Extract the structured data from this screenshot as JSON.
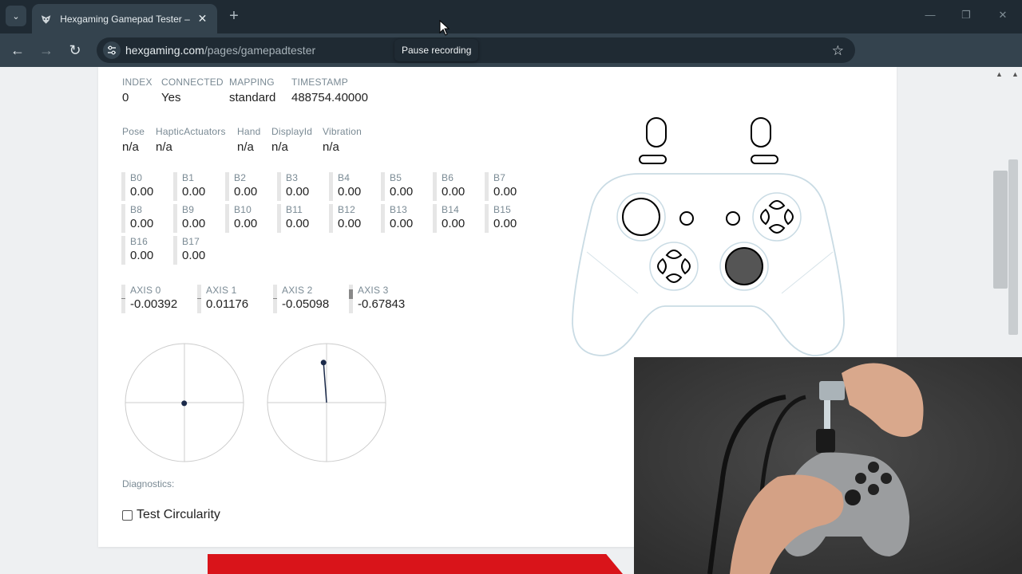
{
  "browser": {
    "tab_title": "Hexgaming Gamepad Tester – H",
    "url_domain": "hexgaming.com",
    "url_path": "/pages/gamepadtester",
    "tooltip": "Pause recording",
    "tab_menu_icon": "chevron-down-icon",
    "new_tab_symbol": "+",
    "close_symbol": "✕"
  },
  "gamepad": {
    "info": [
      {
        "label": "INDEX",
        "value": "0"
      },
      {
        "label": "CONNECTED",
        "value": "Yes"
      },
      {
        "label": "MAPPING",
        "value": "standard"
      },
      {
        "label": "TIMESTAMP",
        "value": "488754.40000"
      }
    ],
    "props": [
      {
        "label": "Pose",
        "value": "n/a"
      },
      {
        "label": "HapticActuators",
        "value": "n/a"
      },
      {
        "label": "Hand",
        "value": "n/a"
      },
      {
        "label": "DisplayId",
        "value": "n/a"
      },
      {
        "label": "Vibration",
        "value": "n/a"
      }
    ],
    "buttons": [
      {
        "label": "B0",
        "value": "0.00"
      },
      {
        "label": "B1",
        "value": "0.00"
      },
      {
        "label": "B2",
        "value": "0.00"
      },
      {
        "label": "B3",
        "value": "0.00"
      },
      {
        "label": "B4",
        "value": "0.00"
      },
      {
        "label": "B5",
        "value": "0.00"
      },
      {
        "label": "B6",
        "value": "0.00"
      },
      {
        "label": "B7",
        "value": "0.00"
      },
      {
        "label": "B8",
        "value": "0.00"
      },
      {
        "label": "B9",
        "value": "0.00"
      },
      {
        "label": "B10",
        "value": "0.00"
      },
      {
        "label": "B11",
        "value": "0.00"
      },
      {
        "label": "B12",
        "value": "0.00"
      },
      {
        "label": "B13",
        "value": "0.00"
      },
      {
        "label": "B14",
        "value": "0.00"
      },
      {
        "label": "B15",
        "value": "0.00"
      },
      {
        "label": "B16",
        "value": "0.00"
      },
      {
        "label": "B17",
        "value": "0.00"
      }
    ],
    "axes": [
      {
        "label": "AXIS 0",
        "value": "-0.00392",
        "num": -0.00392
      },
      {
        "label": "AXIS 1",
        "value": "0.01176",
        "num": 0.01176
      },
      {
        "label": "AXIS 2",
        "value": "-0.05098",
        "num": -0.05098
      },
      {
        "label": "AXIS 3",
        "value": "-0.67843",
        "num": -0.67843
      }
    ],
    "diagnostics_label": "Diagnostics:",
    "test_circularity_label": "Test Circularity",
    "test_circularity_checked": false,
    "right_stick_pressed": true
  },
  "colors": {
    "stick_dot": "#1b2a4a",
    "controller_outline": "#c9dbe4",
    "pressed_fill": "#555555",
    "banner": "#d9141a"
  }
}
